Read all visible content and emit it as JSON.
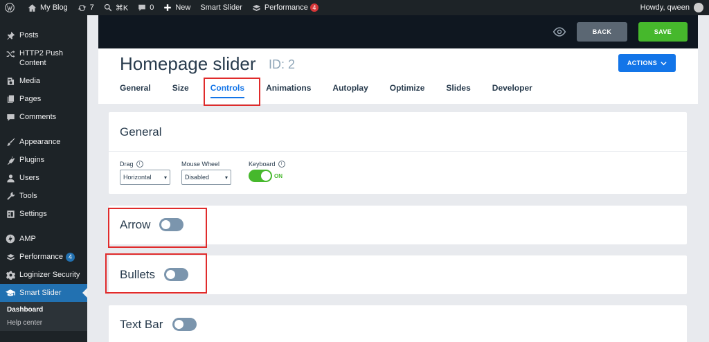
{
  "adminbar": {
    "site_name": "My Blog",
    "updates_count": "7",
    "search_shortcut": "⌘K",
    "comments_count": "0",
    "new_label": "New",
    "smart_slider": "Smart Slider",
    "performance_label": "Performance",
    "performance_badge": "4",
    "howdy": "Howdy, qween"
  },
  "sidebar": {
    "items": [
      {
        "label": "Posts",
        "icon": "pin-icon"
      },
      {
        "label": "HTTP2 Push Content",
        "icon": "shuffle-icon"
      },
      {
        "label": "Media",
        "icon": "media-icon"
      },
      {
        "label": "Pages",
        "icon": "pages-icon"
      },
      {
        "label": "Comments",
        "icon": "comment-icon"
      },
      {
        "label": "Appearance",
        "icon": "brush-icon"
      },
      {
        "label": "Plugins",
        "icon": "plug-icon"
      },
      {
        "label": "Users",
        "icon": "user-icon"
      },
      {
        "label": "Tools",
        "icon": "wrench-icon"
      },
      {
        "label": "Settings",
        "icon": "settings-icon"
      },
      {
        "label": "AMP",
        "icon": "amp-icon"
      },
      {
        "label": "Performance",
        "icon": "performance-icon",
        "badge": "4"
      },
      {
        "label": "Loginizer Security",
        "icon": "gear-icon"
      },
      {
        "label": "Smart Slider",
        "icon": "graduation-icon"
      }
    ],
    "submenu": [
      "Dashboard",
      "Help center"
    ]
  },
  "toolbar": {
    "back_label": "BACK",
    "save_label": "SAVE"
  },
  "header": {
    "title": "Homepage slider",
    "id_label": "ID: 2",
    "actions_label": "ACTIONS",
    "tabs": [
      "General",
      "Size",
      "Controls",
      "Animations",
      "Autoplay",
      "Optimize",
      "Slides",
      "Developer"
    ],
    "active_tab": "Controls"
  },
  "general": {
    "title": "General",
    "drag_label": "Drag",
    "drag_value": "Horizontal",
    "mousewheel_label": "Mouse Wheel",
    "mousewheel_value": "Disabled",
    "keyboard_label": "Keyboard",
    "keyboard_value": "ON"
  },
  "sections": {
    "arrow": "Arrow",
    "bullets": "Bullets",
    "textbar": "Text Bar"
  },
  "colors": {
    "accent_blue": "#1375e8",
    "save_green": "#46b82c",
    "highlight_red": "#e02b2b",
    "admin_dark": "#1d2327"
  }
}
